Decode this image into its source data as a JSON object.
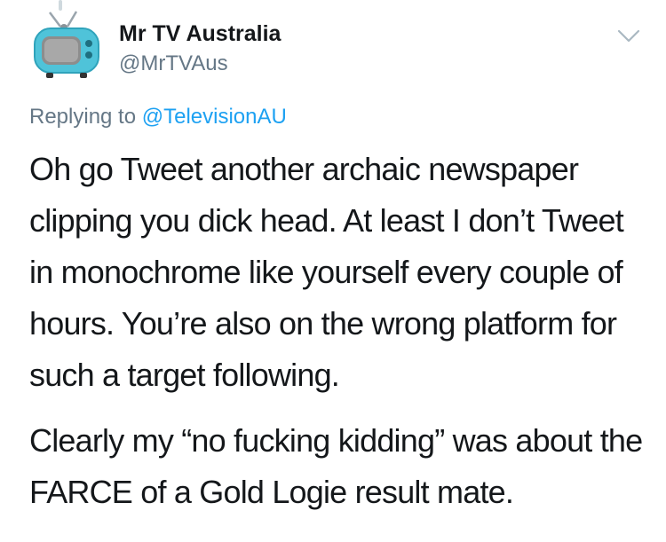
{
  "tweet": {
    "author": {
      "display_name": "Mr TV Australia",
      "handle": "@MrTVAus",
      "avatar_icon": "retro-tv-icon"
    },
    "menu_icon": "chevron-down-icon",
    "replying_to": {
      "prefix": "Replying to",
      "mention": "@TelevisionAU"
    },
    "paragraphs": [
      "Oh go Tweet another archaic newspaper clipping you dick head. At least I don’t Tweet in monochrome like yourself every couple of hours. You’re also on the wrong platform for such a target following.",
      "Clearly my “no fucking kidding” was about the FARCE of a Gold Logie result mate."
    ]
  },
  "colors": {
    "text": "#14171a",
    "secondary_text": "#657786",
    "link": "#1da1f2",
    "avatar_tv": "#4fc3d9",
    "thread_line": "#cfd9de"
  }
}
